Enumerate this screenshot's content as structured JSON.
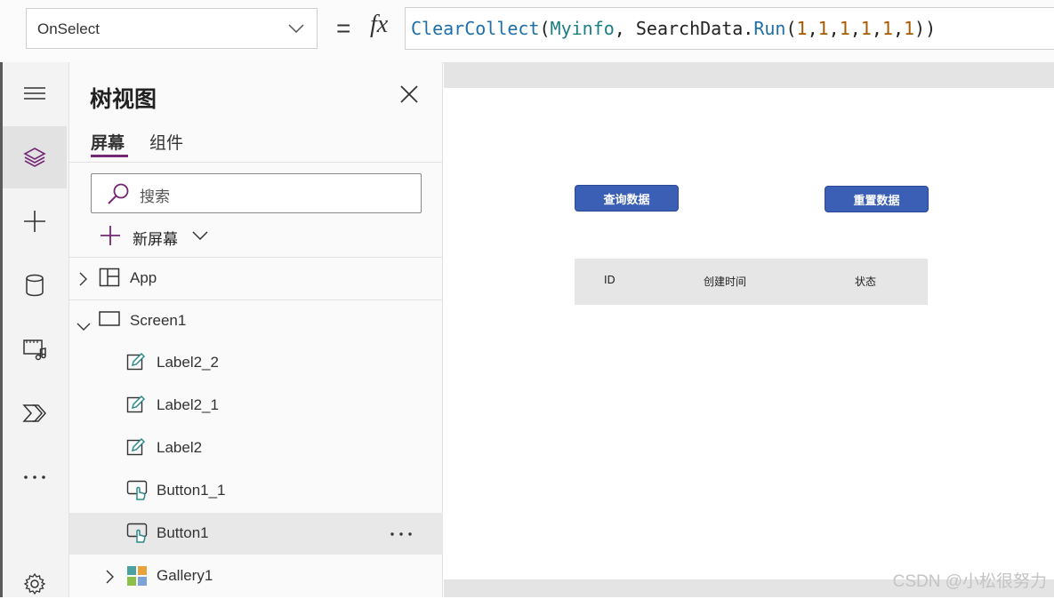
{
  "formula_bar": {
    "property": "OnSelect",
    "equals": "=",
    "fx": "fx",
    "formula_tokens": [
      {
        "text": "ClearCollect",
        "kind": "fn"
      },
      {
        "text": "(",
        "kind": "plain"
      },
      {
        "text": "Myinfo",
        "kind": "id"
      },
      {
        "text": ", SearchData.",
        "kind": "plain"
      },
      {
        "text": "Run",
        "kind": "fn"
      },
      {
        "text": "(",
        "kind": "plain"
      },
      {
        "text": "1",
        "kind": "num"
      },
      {
        "text": ",",
        "kind": "plain"
      },
      {
        "text": "1",
        "kind": "num"
      },
      {
        "text": ",",
        "kind": "plain"
      },
      {
        "text": "1",
        "kind": "num"
      },
      {
        "text": ",",
        "kind": "plain"
      },
      {
        "text": "1",
        "kind": "num"
      },
      {
        "text": ",",
        "kind": "plain"
      },
      {
        "text": "1",
        "kind": "num"
      },
      {
        "text": ",",
        "kind": "plain"
      },
      {
        "text": "1",
        "kind": "num"
      },
      {
        "text": "))",
        "kind": "plain"
      }
    ]
  },
  "rail": {
    "items": [
      {
        "icon": "hamburger-icon",
        "active": false
      },
      {
        "icon": "layers-icon",
        "active": true
      },
      {
        "icon": "plus-icon",
        "active": false
      },
      {
        "icon": "database-icon",
        "active": false
      },
      {
        "icon": "media-icon",
        "active": false
      },
      {
        "icon": "power-automate-icon",
        "active": false
      },
      {
        "icon": "more-icon",
        "active": false
      },
      {
        "icon": "gear-icon",
        "active": false
      }
    ]
  },
  "tree_panel": {
    "title": "树视图",
    "tabs": [
      {
        "label": "屏幕",
        "active": true
      },
      {
        "label": "组件",
        "active": false
      }
    ],
    "search_placeholder": "搜索",
    "new_screen_label": "新屏幕",
    "nodes": [
      {
        "label": "App",
        "icon": "app-icon",
        "expander": "collapsed",
        "level": 0,
        "selected": false
      },
      {
        "label": "Screen1",
        "icon": "screen-icon",
        "expander": "expanded",
        "level": 0,
        "selected": false
      },
      {
        "label": "Label2_2",
        "icon": "label-edit-icon",
        "expander": "none",
        "level": 1,
        "selected": false
      },
      {
        "label": "Label2_1",
        "icon": "label-edit-icon",
        "expander": "none",
        "level": 1,
        "selected": false
      },
      {
        "label": "Label2",
        "icon": "label-edit-icon",
        "expander": "none",
        "level": 1,
        "selected": false
      },
      {
        "label": "Button1_1",
        "icon": "button-tap-icon",
        "expander": "none",
        "level": 1,
        "selected": false
      },
      {
        "label": "Button1",
        "icon": "button-tap-icon",
        "expander": "none",
        "level": 1,
        "selected": true
      },
      {
        "label": "Gallery1",
        "icon": "gallery-icon",
        "expander": "collapsed",
        "level": 1,
        "selected": false
      }
    ]
  },
  "canvas": {
    "buttons": [
      {
        "label": "查询数据"
      },
      {
        "label": "重置数据"
      }
    ],
    "header_labels": [
      "ID",
      "创建时间",
      "状态"
    ]
  },
  "watermark": "CSDN @小松很努力",
  "colors": {
    "accent": "#742774",
    "app_button": "#3b5fb4",
    "icon_teal": "#2e8a8a"
  }
}
